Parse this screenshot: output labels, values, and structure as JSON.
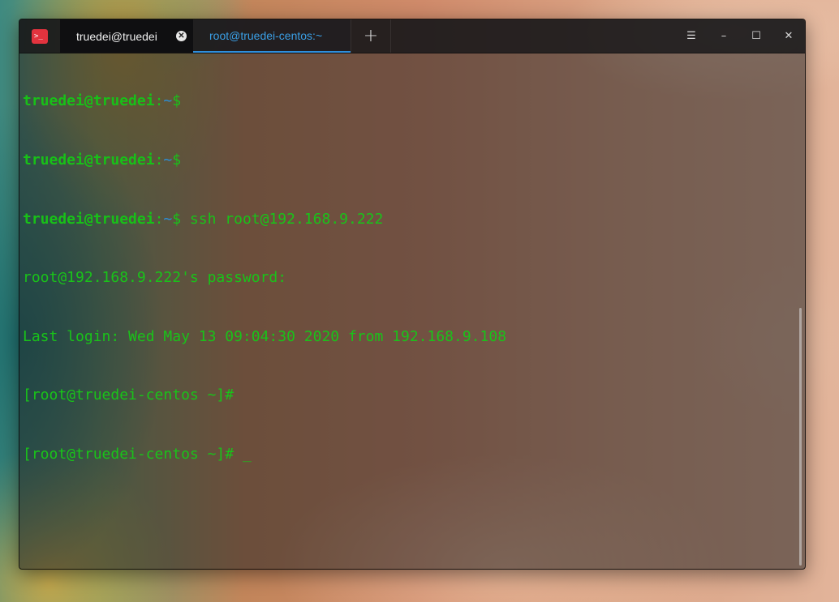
{
  "window": {
    "tabs": [
      {
        "label": "truedei@truedei",
        "active": false
      },
      {
        "label": "root@truedei-centos:~",
        "active": true
      }
    ],
    "new_tab_symbol": "+",
    "controls": {
      "menu": "☰",
      "minimize": "–",
      "maximize": "☐",
      "close": "✕"
    },
    "app_icon_glyph": ">_"
  },
  "terminal": {
    "lines": [
      {
        "user": "truedei@truedei",
        "sep": ":",
        "path": "~",
        "sym": "$",
        "cmd": ""
      },
      {
        "user": "truedei@truedei",
        "sep": ":",
        "path": "~",
        "sym": "$",
        "cmd": ""
      },
      {
        "user": "truedei@truedei",
        "sep": ":",
        "path": "~",
        "sym": "$",
        "cmd": " ssh root@192.168.9.222"
      },
      {
        "text": "root@192.168.9.222's password:"
      },
      {
        "text": "Last login: Wed May 13 09:04:30 2020 from 192.168.9.108"
      },
      {
        "text": "[root@truedei-centos ~]#"
      },
      {
        "text": "[root@truedei-centos ~]# ",
        "cursor": "_"
      }
    ]
  },
  "colors": {
    "prompt_green": "#19c319",
    "path_blue": "#2b8fd8",
    "active_tab_blue": "#3a9fe5",
    "app_icon_red": "#e2333e"
  }
}
